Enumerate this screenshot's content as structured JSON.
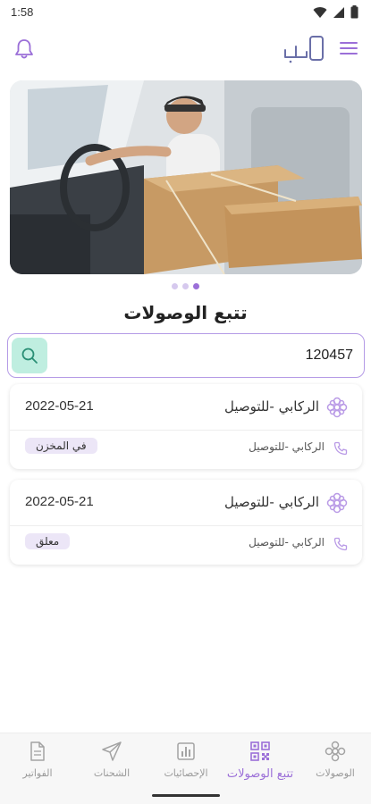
{
  "status_bar": {
    "time": "1:58"
  },
  "header": {
    "bell_icon": "bell-icon",
    "menu_icon": "hamburger-menu-icon",
    "logo_icon": "app-logo"
  },
  "carousel": {
    "slide_count": 3,
    "active_index": 2
  },
  "page": {
    "title": "تتبع الوصولات"
  },
  "search": {
    "value": "120457",
    "button_icon": "search-icon"
  },
  "shipments": [
    {
      "name": "الركابي -للتوصيل",
      "date": "2022-05-21",
      "sub": "الركابي -للتوصيل",
      "status": "في المخزن"
    },
    {
      "name": "الركابي -للتوصيل",
      "date": "2022-05-21",
      "sub": "الركابي -للتوصيل",
      "status": "معلق"
    }
  ],
  "nav": {
    "items": [
      {
        "label": "الوصولات",
        "icon": "lattice-icon",
        "active": false
      },
      {
        "label": "تتبع الوصولات",
        "icon": "qr-code-icon",
        "active": true
      },
      {
        "label": "الإحصائيات",
        "icon": "stats-icon",
        "active": false
      },
      {
        "label": "الشحنات",
        "icon": "send-icon",
        "active": false
      },
      {
        "label": "الفواتير",
        "icon": "document-icon",
        "active": false
      }
    ]
  },
  "colors": {
    "accent": "#9b6fd8",
    "search_btn": "#bfeee0",
    "badge_bg": "#ece6f7",
    "border": "#b59be6"
  }
}
